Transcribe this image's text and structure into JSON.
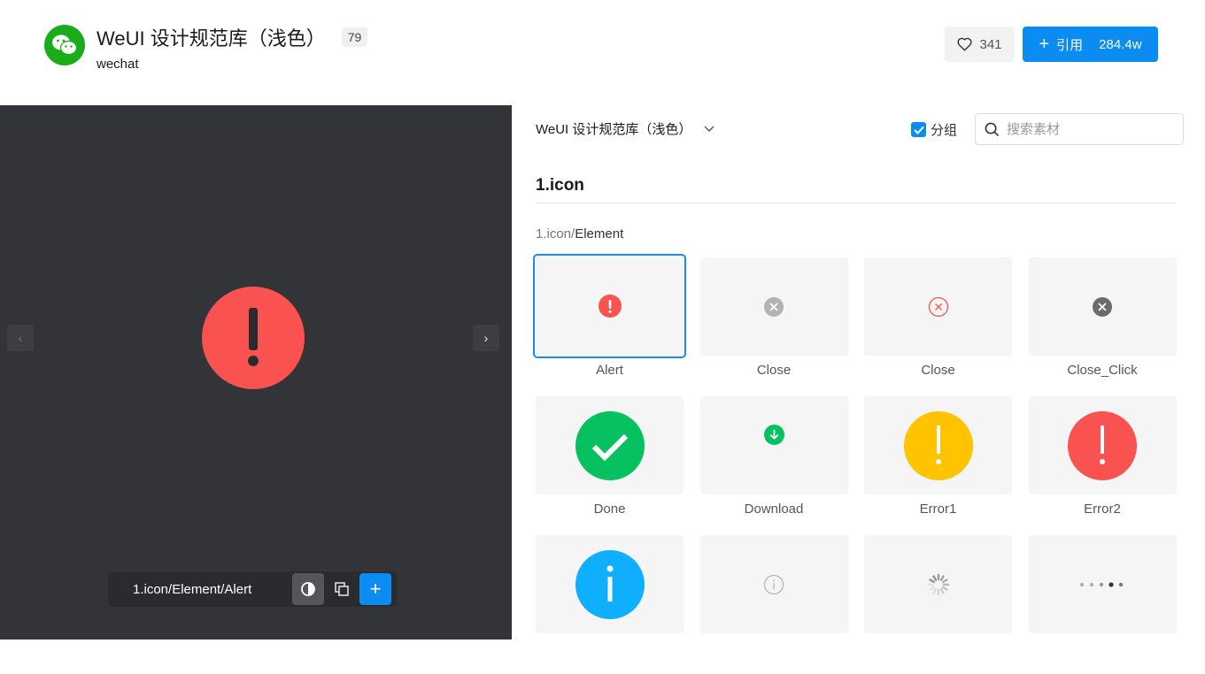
{
  "header": {
    "title": "WeUI 设计规范库（浅色）",
    "count": "79",
    "subtitle": "wechat",
    "likes": "341",
    "cite_label": "引用",
    "cite_count": "284.4w"
  },
  "preview": {
    "path": "1.icon/Element/Alert"
  },
  "panel": {
    "library": "WeUI 设计规范库（浅色）",
    "group_label": "分组",
    "search_placeholder": "搜索素材",
    "section": "1.icon",
    "breadcrumb_parent": "1.icon/",
    "breadcrumb_current": "Element",
    "items": [
      {
        "label": "Alert",
        "icon": "alert-icon"
      },
      {
        "label": "Close",
        "icon": "close-gray-icon"
      },
      {
        "label": "Close",
        "icon": "close-red-outline-icon"
      },
      {
        "label": "Close_Click",
        "icon": "close-dark-icon"
      },
      {
        "label": "Done",
        "icon": "done-icon"
      },
      {
        "label": "Download",
        "icon": "download-icon"
      },
      {
        "label": "Error1",
        "icon": "error-yellow-icon"
      },
      {
        "label": "Error2",
        "icon": "error-red-icon"
      },
      {
        "label": "",
        "icon": "info-blue-icon"
      },
      {
        "label": "",
        "icon": "info-outline-icon"
      },
      {
        "label": "",
        "icon": "loading-icon"
      },
      {
        "label": "",
        "icon": "dots-icon"
      }
    ]
  },
  "colors": {
    "primary": "#0a8cf0",
    "wechat_green": "#1aad19",
    "alert_red": "#fa5151",
    "success_green": "#07c160",
    "warning_yellow": "#ffc300",
    "info_blue": "#10aeff",
    "preview_bg": "#333438"
  }
}
